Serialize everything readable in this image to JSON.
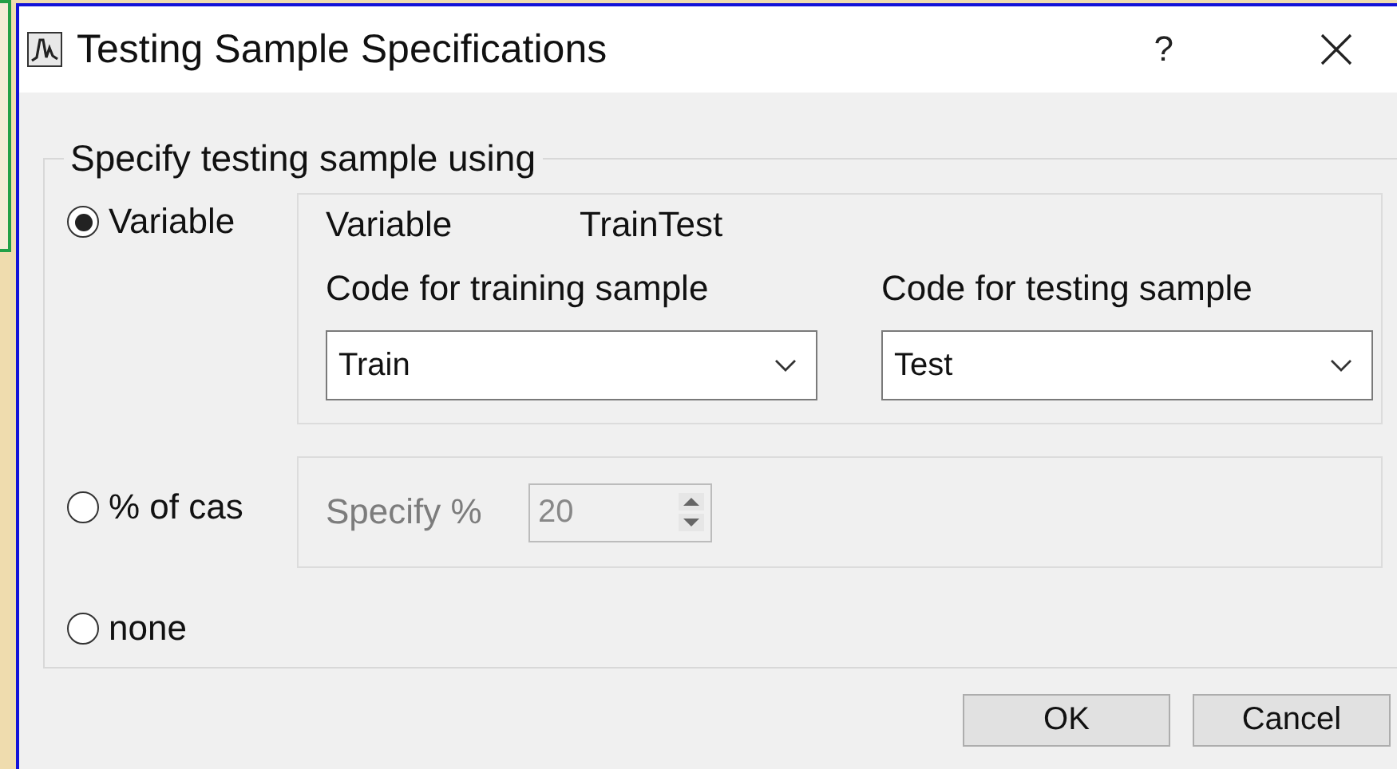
{
  "window": {
    "title": "Testing Sample Specifications",
    "help": "?"
  },
  "group": {
    "legend": "Specify testing sample using",
    "options": [
      {
        "label": "Variable",
        "selected": true
      },
      {
        "label": "% of cas",
        "selected": false
      },
      {
        "label": "none",
        "selected": false
      }
    ]
  },
  "variable_panel": {
    "variable_label": "Variable",
    "variable_value": "TrainTest",
    "training": {
      "label": "Code for training sample",
      "value": "Train"
    },
    "testing": {
      "label": "Code for testing sample",
      "value": "Test"
    }
  },
  "percent_panel": {
    "label": "Specify %",
    "value": "20",
    "disabled": true
  },
  "buttons": [
    "OK",
    "Cancel"
  ]
}
